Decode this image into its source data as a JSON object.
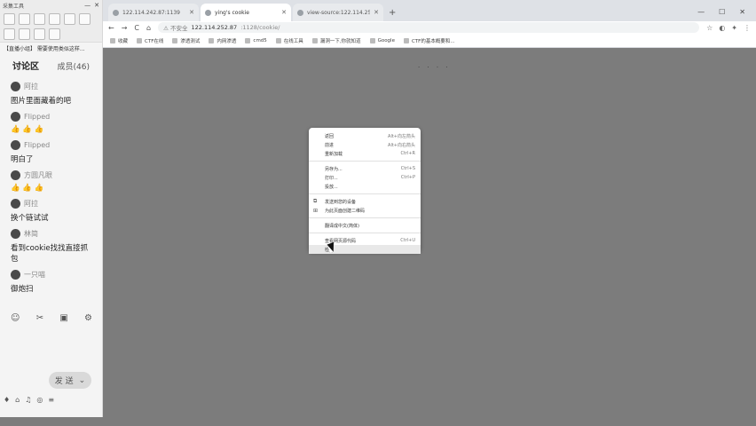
{
  "chat": {
    "window_title": "采集工具",
    "notice": "【直播小组】 需要使用类似这样...",
    "heading": "讨论区",
    "member_count": "成员(46)",
    "messages": [
      {
        "user": "阿拉",
        "text": "图片里面藏着的吧"
      },
      {
        "user": "Flipped",
        "text": "👍 👍 👍"
      },
      {
        "user": "Flipped",
        "text": "明白了"
      },
      {
        "user": "方圆凡眼",
        "text": "👍 👍 👍"
      },
      {
        "user": "阿拉",
        "text": "换个链试试"
      },
      {
        "user": "林简",
        "text": "看到cookie找找直接抓包"
      },
      {
        "user": "一只喵",
        "text": "御炮扫"
      }
    ],
    "tool_icons": [
      "☺",
      "✂",
      "▣",
      "⚙"
    ],
    "send_label": "发 送",
    "send_arrow": "⌄",
    "bottom_icons": [
      "♦",
      "⌂",
      "♫",
      "◎",
      "≡"
    ]
  },
  "browser": {
    "tabs": [
      {
        "label": "122.114.242.87:1139",
        "active": false
      },
      {
        "label": "ying's cookie",
        "active": true
      },
      {
        "label": "view-source:122.114.252.87...",
        "active": false
      }
    ],
    "new_tab": "+",
    "window_controls": [
      "—",
      "☐",
      "✕"
    ],
    "nav": {
      "back": "←",
      "forward": "→",
      "reload": "C",
      "home": "⌂"
    },
    "address": {
      "security": "⚠ 不安全",
      "host": "122.114.252.87",
      "path": ":1128/cookie/"
    },
    "ext_icons": [
      "☆",
      "◐",
      "✦",
      "⋮"
    ],
    "bookmarks": [
      "收藏",
      "CTF在线",
      "渗透测试",
      "内网渗透",
      "cmd5",
      "在线工具",
      "漏洞一下,你就知道",
      "Google",
      "CTF的基本概要和..."
    ]
  },
  "context_menu": {
    "items": [
      {
        "label": "返回",
        "shortcut": "Alt+向左箭头"
      },
      {
        "label": "前进",
        "shortcut": "Alt+向右箭头"
      },
      {
        "label": "重新加载",
        "shortcut": "Ctrl+R"
      },
      {
        "sep": true
      },
      {
        "label": "另存为...",
        "shortcut": "Ctrl+S"
      },
      {
        "label": "打印...",
        "shortcut": "Ctrl+P"
      },
      {
        "label": "投放...",
        "shortcut": ""
      },
      {
        "sep": true
      },
      {
        "label": "发送到您的设备",
        "shortcut": "",
        "icon": "⧉"
      },
      {
        "label": "为此页面创建二维码",
        "shortcut": "",
        "icon": "⊞"
      },
      {
        "sep": true
      },
      {
        "label": "翻译成中文(简体)",
        "shortcut": ""
      },
      {
        "sep": true
      },
      {
        "label": "查看网页源代码",
        "shortcut": "Ctrl+U"
      },
      {
        "label": "检查",
        "shortcut": "",
        "highlighted": true
      }
    ]
  }
}
